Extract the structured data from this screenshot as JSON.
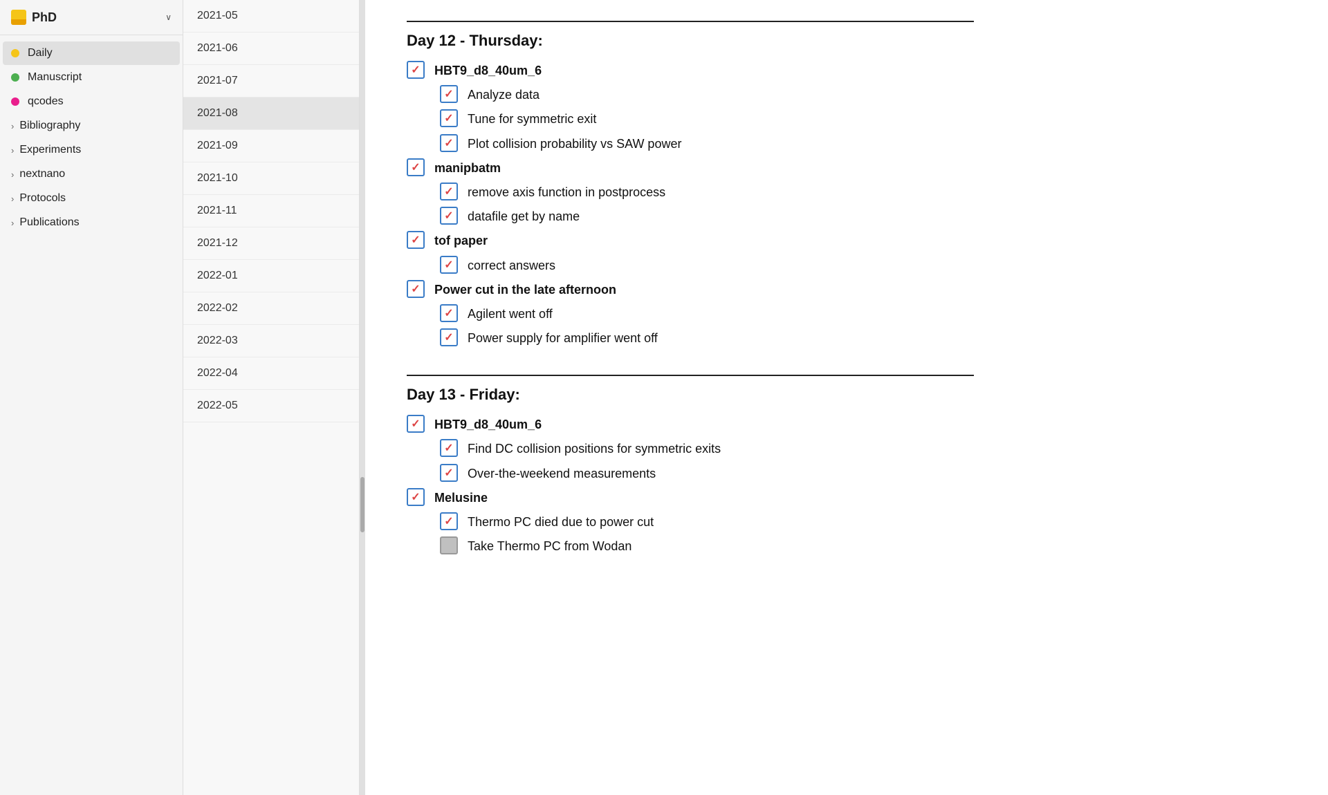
{
  "app": {
    "title": "PhD",
    "title_chevron": "∨"
  },
  "sidebar": {
    "sort_icon": "↨",
    "items": [
      {
        "id": "daily",
        "label": "Daily",
        "type": "dot",
        "color": "#f5c518",
        "active": true
      },
      {
        "id": "manuscript",
        "label": "Manuscript",
        "type": "dot",
        "color": "#4caf50"
      },
      {
        "id": "qcodes",
        "label": "qcodes",
        "type": "dot",
        "color": "#e91e8c"
      },
      {
        "id": "bibliography",
        "label": "Bibliography",
        "type": "chevron"
      },
      {
        "id": "experiments",
        "label": "Experiments",
        "type": "chevron"
      },
      {
        "id": "nextnano",
        "label": "nextnano",
        "type": "chevron"
      },
      {
        "id": "protocols",
        "label": "Protocols",
        "type": "chevron"
      },
      {
        "id": "publications",
        "label": "Publications",
        "type": "chevron"
      }
    ]
  },
  "dates": [
    {
      "id": "2021-05",
      "label": "2021-05"
    },
    {
      "id": "2021-06",
      "label": "2021-06"
    },
    {
      "id": "2021-07",
      "label": "2021-07"
    },
    {
      "id": "2021-08",
      "label": "2021-08",
      "active": true
    },
    {
      "id": "2021-09",
      "label": "2021-09"
    },
    {
      "id": "2021-10",
      "label": "2021-10"
    },
    {
      "id": "2021-11",
      "label": "2021-11"
    },
    {
      "id": "2021-12",
      "label": "2021-12"
    },
    {
      "id": "2022-01",
      "label": "2022-01"
    },
    {
      "id": "2022-02",
      "label": "2022-02"
    },
    {
      "id": "2022-03",
      "label": "2022-03"
    },
    {
      "id": "2022-04",
      "label": "2022-04"
    },
    {
      "id": "2022-05",
      "label": "2022-05"
    }
  ],
  "days": [
    {
      "id": "day12",
      "title": "Day 12 - Thursday:",
      "tasks": [
        {
          "text": "HBT9_d8_40um_6",
          "checked": true,
          "bold": true,
          "sub": [
            {
              "text": "Analyze data",
              "checked": true
            },
            {
              "text": "Tune for symmetric exit",
              "checked": true
            },
            {
              "text": "Plot collision probability vs SAW power",
              "checked": true
            }
          ]
        },
        {
          "text": "manipbatm",
          "checked": true,
          "bold": true,
          "sub": [
            {
              "text": "remove axis function in postprocess",
              "checked": true
            },
            {
              "text": "datafile get by name",
              "checked": true
            }
          ]
        },
        {
          "text": "tof paper",
          "checked": true,
          "bold": true,
          "sub": [
            {
              "text": "correct answers",
              "checked": true
            }
          ]
        },
        {
          "text": "Power cut in the late afternoon",
          "checked": true,
          "bold": true,
          "sub": [
            {
              "text": "Agilent went off",
              "checked": true
            },
            {
              "text": "Power supply for amplifier went off",
              "checked": true
            }
          ]
        }
      ]
    },
    {
      "id": "day13",
      "title": "Day 13 - Friday:",
      "tasks": [
        {
          "text": "HBT9_d8_40um_6",
          "checked": true,
          "bold": true,
          "sub": [
            {
              "text": "Find DC collision positions for symmetric exits",
              "checked": true
            },
            {
              "text": "Over-the-weekend measurements",
              "checked": true
            }
          ]
        },
        {
          "text": "Melusine",
          "checked": true,
          "bold": true,
          "sub": [
            {
              "text": "Thermo PC died due to power cut",
              "checked": true
            },
            {
              "text": "Take Thermo PC from Wodan",
              "checked": true,
              "partial": true
            }
          ]
        }
      ]
    }
  ]
}
